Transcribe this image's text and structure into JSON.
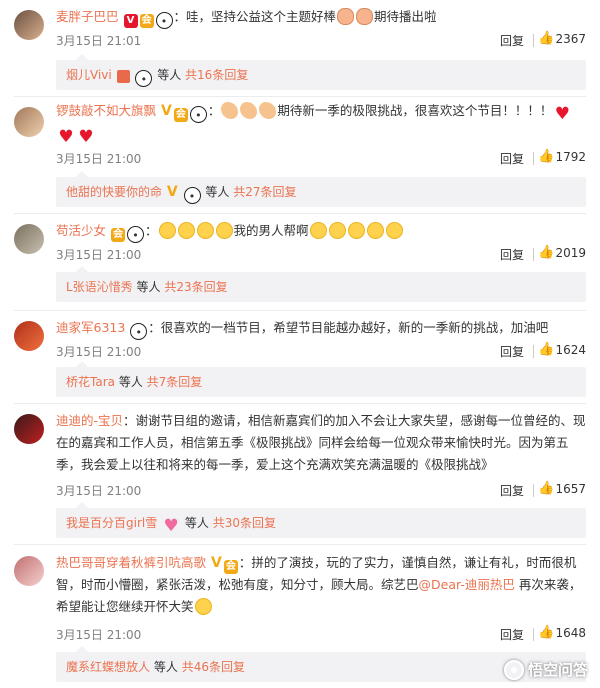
{
  "comments": [
    {
      "username": "麦胖子巴巴",
      "text_a": "：哇，坚持公益这个主题好棒",
      "text_b": "期待播出啦",
      "date": "3月15日 21:01",
      "reply_label": "回复",
      "likes": "2367",
      "sub_user": "烟儿Vivi",
      "sub_middle": "等人",
      "sub_total": "共16条回复"
    },
    {
      "username": "锣鼓敲不如大旗飘",
      "text_a": "期待新一季的极限挑战，很喜欢这个节目！！！！",
      "date": "3月15日 21:00",
      "reply_label": "回复",
      "likes": "1792",
      "sub_user": "他甜的快要你的命",
      "sub_middle": "等人",
      "sub_total": "共27条回复"
    },
    {
      "username": "苟活少女",
      "text_a": "我的男人帮啊",
      "date": "3月15日 21:00",
      "reply_label": "回复",
      "likes": "2019",
      "sub_user": "L张语沁惜秀",
      "sub_middle": "等人",
      "sub_total": "共23条回复"
    },
    {
      "username": "迪家军6313",
      "text_a": "：很喜欢的一档节目，希望节目能越办越好，新的一季新的挑战，加油吧",
      "date": "3月15日 21:00",
      "reply_label": "回复",
      "likes": "1624",
      "sub_user": "桥花Tara",
      "sub_middle": "等人",
      "sub_total": "共7条回复"
    },
    {
      "username": "迪迪的-宝贝",
      "text_a": "：谢谢节目组的邀请，相信新嘉宾们的加入不会让大家失望，感谢每一位曾经的、现在的嘉宾和工作人员，相信第五季《极限挑战》同样会给每一位观众带来愉快时光。因为第五季，我会爱上以往和将来的每一季，爱上这个充满欢笑充满温暖的《极限挑战》",
      "date": "3月15日 21:00",
      "reply_label": "回复",
      "likes": "1657",
      "sub_user": "我是百分百girl雪",
      "sub_middle": "等人",
      "sub_total": "共30条回复"
    },
    {
      "username": "热巴哥哥穿着秋裤引吭高歌",
      "text_a": "：拼的了演技，玩的了实力，谨慎自然，谦让有礼，时而很机智，时而小懵圈，紧张活泼，松弛有度，知分寸，顾大局。综艺巴",
      "mention": "@Dear-迪丽热巴",
      "text_b": " 再次来袭，希望能让您继续开怀大笑",
      "date": "3月15日 21:00",
      "reply_label": "回复",
      "likes": "1648",
      "sub_user": "魔系红蝶想放人",
      "sub_middle": "等人",
      "sub_total": "共46条回复"
    }
  ],
  "watermark": "悟空问答",
  "colors": {
    "accent": "#eb7350",
    "subbox_bg": "#f2f2f5",
    "badge_red": "#e6162d",
    "badge_gold": "#f2a917"
  },
  "icons": {
    "like": "thumbs-up-icon",
    "panda": "panda-emoji-icon",
    "verified": "verified-v-icon"
  }
}
